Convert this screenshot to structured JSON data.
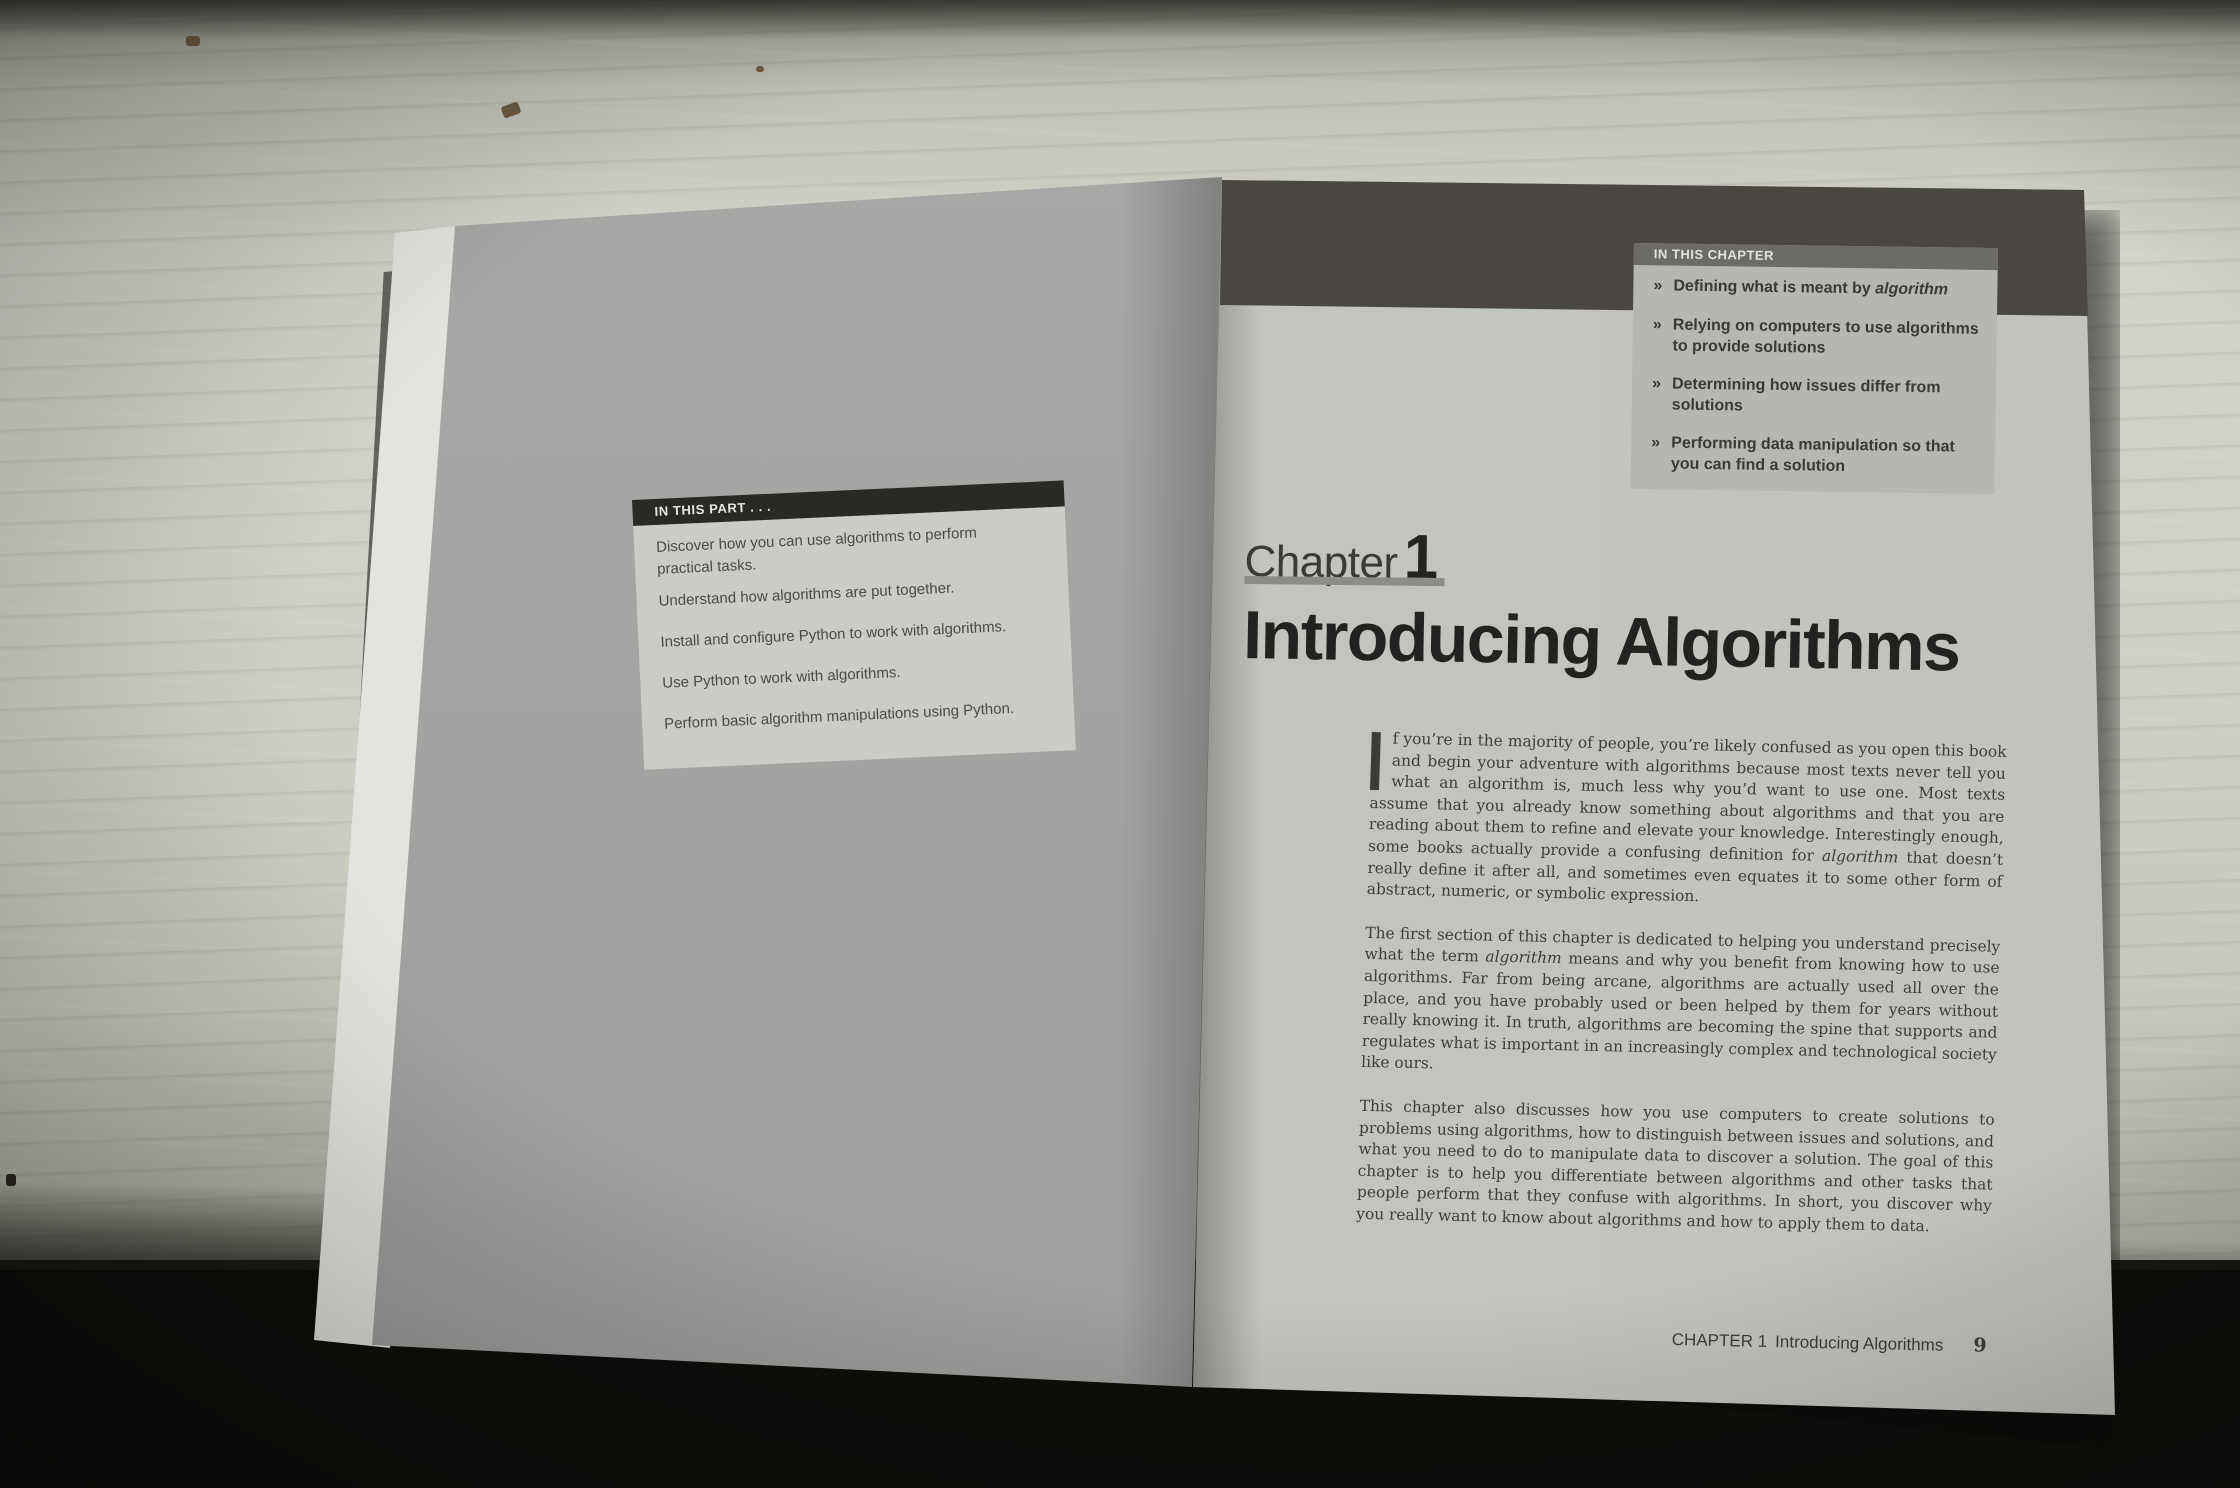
{
  "photo": {
    "subject": "open book on windowsill",
    "colors": {
      "sill": "#cfd0c7",
      "left_page": "#a3a4a2",
      "right_page": "#c3c4c0",
      "header_band": "#4a4743"
    }
  },
  "left_page": {
    "box_heading": "IN THIS PART . . .",
    "items": [
      "Discover how you can use algorithms to perform practical tasks.",
      "Understand how algorithms are put together.",
      "Install and configure Python to work with algorithms.",
      "Use Python to work with algorithms.",
      "Perform basic algorithm manipulations using Python."
    ]
  },
  "right_page": {
    "box_heading": "IN THIS CHAPTER",
    "bullet": "»",
    "items": [
      {
        "text": "Defining what is meant by ",
        "emph": "algorithm"
      },
      {
        "text": "Relying on computers to use algorithms to provide solutions",
        "emph": ""
      },
      {
        "text": "Determining how issues differ from solutions",
        "emph": ""
      },
      {
        "text": "Performing data manipulation so that you can find a solution",
        "emph": ""
      }
    ],
    "chapter_word": "Chapter",
    "chapter_number": "1",
    "chapter_title": "Introducing Algorithms",
    "paragraphs": [
      {
        "a": "f you’re in the majority of people, you’re likely confused as you open this book and begin your adventure with algorithms because most texts never tell you what an algorithm is, much less why you’d want to use one. Most texts assume that you already know something about algorithms and that you are reading about them to refine and elevate your knowledge. Interestingly enough, some books actually provide a confusing definition for ",
        "em": "algorithm",
        "b": " that doesn’t really define it after all, and sometimes even equates it to some other form of abstract, numeric, or symbolic expression."
      },
      {
        "a": "The first section of this chapter is dedicated to helping you understand precisely what the term ",
        "em": "algorithm",
        "b": " means and why you benefit from knowing how to use algorithms. Far from being arcane, algorithms are actually used all over the place, and you have probably used or been helped by them for years without really knowing it. In truth, algorithms are becoming the spine that supports and regulates what is important in an increasingly complex and technological society like ours."
      },
      {
        "a": "This chapter also discusses how you use computers to create solutions to problems using algorithms, how to distinguish between issues and solutions, and what you need to do to manipulate data to discover a solution. The goal of this chapter is to help you differentiate between algorithms and other tasks that people perform that they confuse with algorithms. In short, you discover why you really want to know about algorithms and how to apply them to data.",
        "em": "",
        "b": ""
      }
    ],
    "footer": {
      "chapter": "CHAPTER 1",
      "title": "Introducing Algorithms",
      "page": "9"
    }
  }
}
